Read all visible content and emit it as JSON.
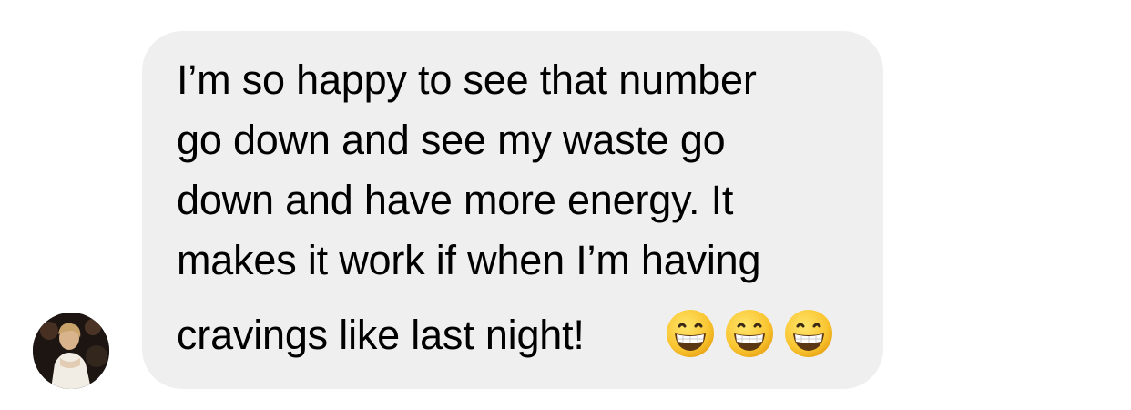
{
  "conversation": {
    "message": {
      "lines": [
        "I’m so happy to see that number",
        "go down and see my waste go",
        "down and have more energy. It",
        "makes it work if when I’m having",
        "cravings like last night!"
      ],
      "emojis": [
        "😁",
        "😁",
        "😁"
      ]
    },
    "sender": {
      "avatar_icon": "profile-photo"
    }
  },
  "colors": {
    "bubble": "#efefef",
    "text": "#000000",
    "background": "#ffffff"
  }
}
